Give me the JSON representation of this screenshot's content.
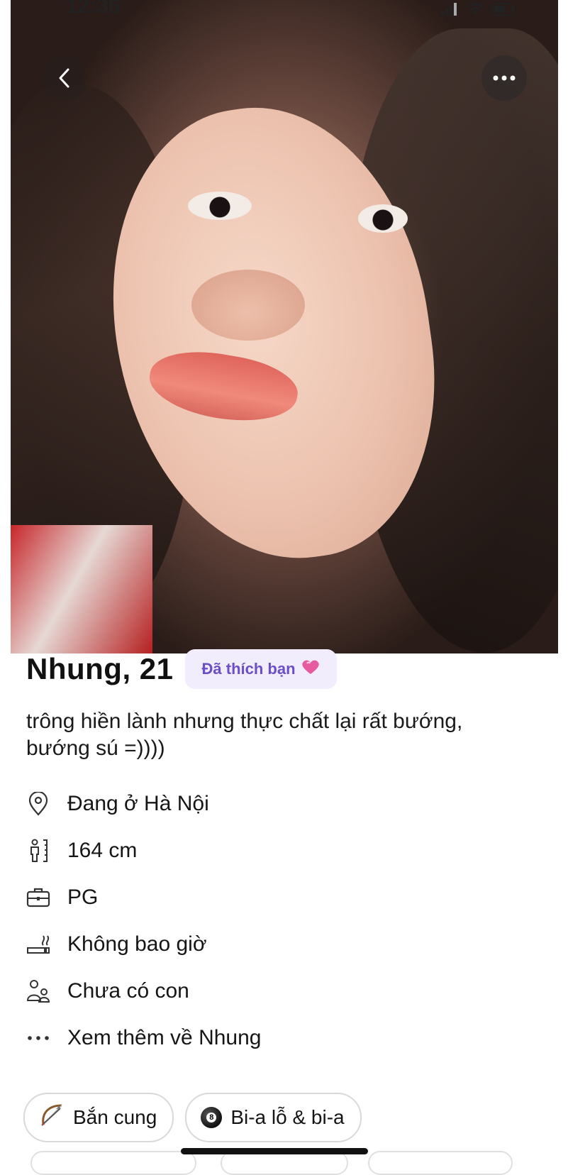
{
  "status_bar": {
    "time": "12:36",
    "icons": [
      "signal-icon",
      "wifi-icon",
      "battery-icon"
    ]
  },
  "photo": {
    "back_icon": "chevron-left-icon",
    "more_icon": "more-horizontal-icon"
  },
  "profile": {
    "name_age": "Nhung, 21",
    "liked_badge": "Đã thích bạn",
    "liked_badge_icon": "heart-icon",
    "bio_line1": "trông hiền lành nhưng thực chất lại rất bướng,",
    "bio_line2": "bướng sú =))))"
  },
  "details": [
    {
      "icon": "location-pin-icon",
      "label": "Đang ở Hà Nội"
    },
    {
      "icon": "height-icon",
      "label": "164 cm"
    },
    {
      "icon": "briefcase-icon",
      "label": "PG"
    },
    {
      "icon": "smoking-icon",
      "label": "Không bao giờ"
    },
    {
      "icon": "children-icon",
      "label": "Chưa có con"
    },
    {
      "icon": "more-dots-icon",
      "label": "Xem thêm về Nhung"
    }
  ],
  "interests": [
    {
      "icon": "bow-arrow-icon",
      "label": "Bắn cung"
    },
    {
      "icon": "billiard-ball-icon",
      "label": "Bi-a lỗ & bi-a"
    }
  ],
  "colors": {
    "badge_bg": "#f1edfc",
    "badge_text": "#6b4fc9",
    "text": "#111111"
  }
}
